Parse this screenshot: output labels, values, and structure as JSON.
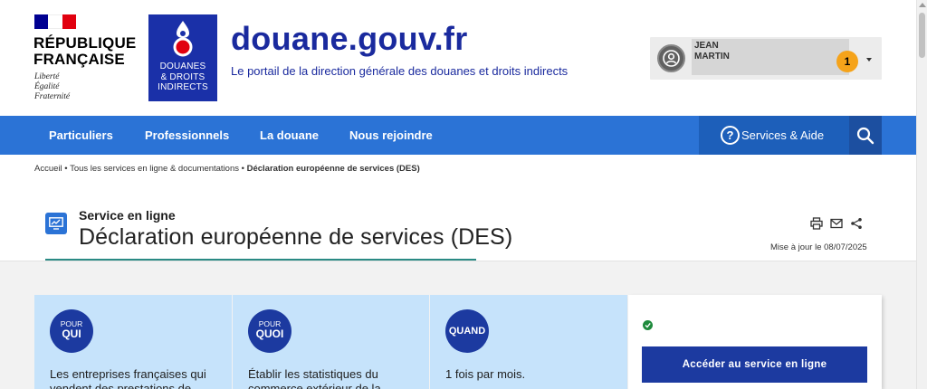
{
  "header": {
    "republic_name": "RÉPUBLIQUE\nFRANÇAISE",
    "motto": "Liberté\nÉgalité\nFraternité",
    "agency_logo_text": "DOUANES\n& DROITS\nINDIRECTS",
    "site_title": "douane.gouv.fr",
    "site_tagline": "Le portail de la direction générale des douanes et droits indirects",
    "user": {
      "first_name": "JEAN",
      "last_name": "MARTIN",
      "notification_count": "1"
    }
  },
  "nav": {
    "items": [
      {
        "label": "Particuliers"
      },
      {
        "label": "Professionnels"
      },
      {
        "label": "La douane"
      },
      {
        "label": "Nous rejoindre"
      }
    ],
    "services_label": "Services & Aide"
  },
  "breadcrumb": {
    "home": "Accueil",
    "parent": "Tous les services en ligne & documentations",
    "current": "Déclaration européenne de services (DES)"
  },
  "service": {
    "kicker": "Service en ligne",
    "title": "Déclaration européenne de services (DES)",
    "updated": "Mise à jour le 08/07/2025"
  },
  "cards": [
    {
      "small": "POUR",
      "large": "QUI",
      "text": "Les entreprises françaises qui vendent des prestations de"
    },
    {
      "small": "POUR",
      "large": "QUOI",
      "text": "Établir les statistiques du commerce extérieur de la"
    },
    {
      "large": "QUAND",
      "text": "1 fois par mois."
    }
  ],
  "cta_label": "Accéder au service en ligne",
  "colors": {
    "brand_blue": "#1a2a9e",
    "nav_blue": "#2b73d6",
    "card_blue": "#c6e3fb",
    "badge_orange": "#f5a31a"
  }
}
